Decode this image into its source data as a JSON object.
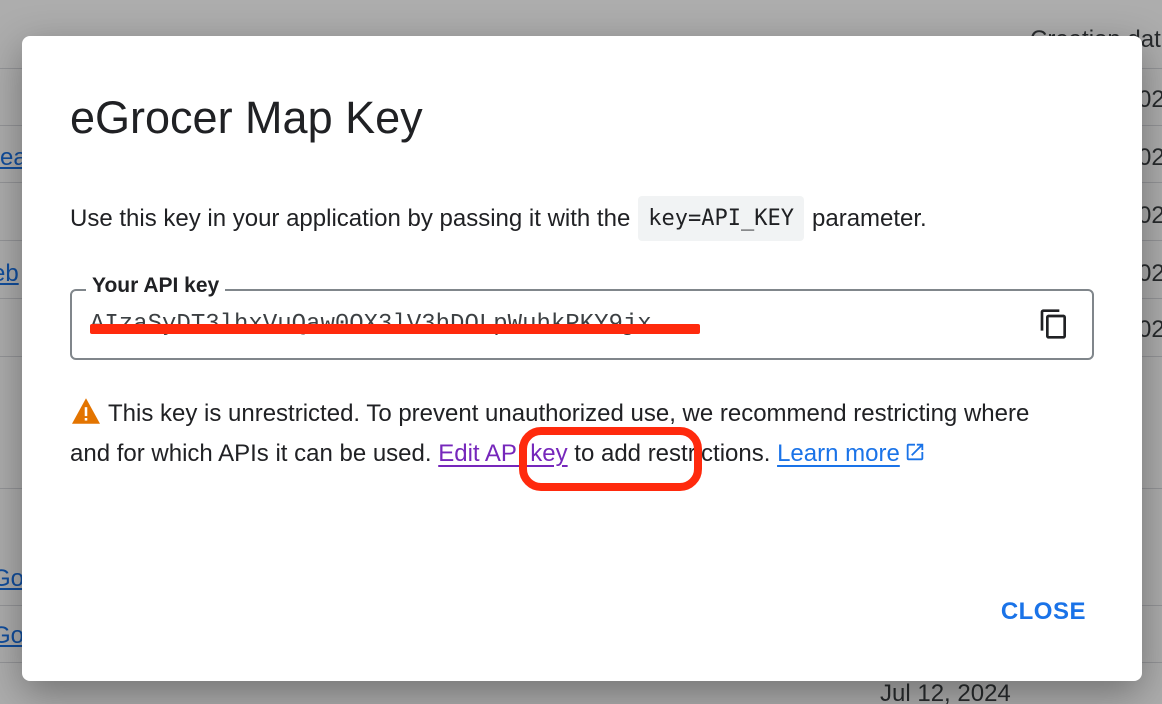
{
  "background": {
    "column_header": "Creation dat",
    "row_dates_partial": [
      "02",
      "02",
      "02",
      "02",
      "02"
    ],
    "left_links_partial": [
      "rea",
      "eb",
      "Go",
      "Go"
    ],
    "bottom_date": "Jul 12, 2024"
  },
  "dialog": {
    "title": "eGrocer Map Key",
    "intro_before": "Use this key in your application by passing it with the",
    "intro_code": "key=API_KEY",
    "intro_after": "parameter.",
    "key_field": {
      "label": "Your API key",
      "value": "AIzaSyDT3lhxVuQaw0OX3lV3hDOLpWuhkPKY9jx",
      "redacted": true
    },
    "warning": {
      "text_before": "This key is unrestricted. To prevent unauthorized use, we recommend restricting where and for which APIs it can be used.",
      "edit_link": "Edit API key",
      "text_after": "to add restrictions.",
      "learn_link": "Learn more"
    },
    "close_label": "CLOSE"
  },
  "icons": {
    "copy": "copy-icon",
    "warning": "warning-icon",
    "external": "open-in-new-icon"
  },
  "colors": {
    "primary": "#1a73e8",
    "visited_link": "#7627bb",
    "warning": "#e37400",
    "annotation": "#ff2a0d"
  }
}
